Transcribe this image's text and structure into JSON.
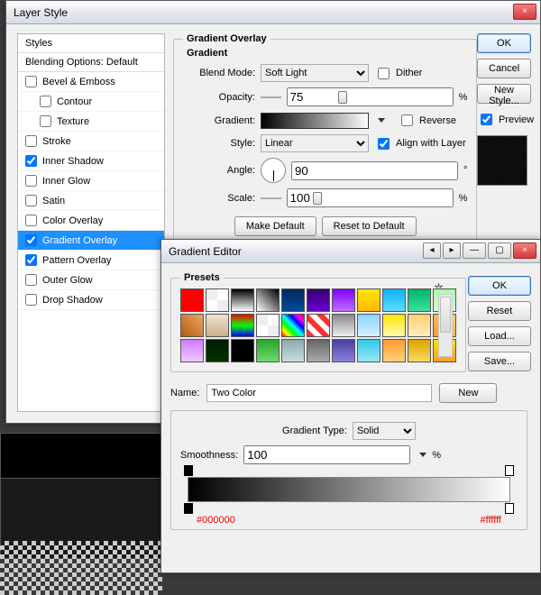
{
  "layer_style": {
    "title": "Layer Style",
    "list_header": "Styles",
    "blending_label": "Blending Options: Default",
    "effects": [
      {
        "label": "Bevel & Emboss",
        "checked": false,
        "selected": false,
        "indent": 0
      },
      {
        "label": "Contour",
        "checked": false,
        "selected": false,
        "indent": 1
      },
      {
        "label": "Texture",
        "checked": false,
        "selected": false,
        "indent": 1
      },
      {
        "label": "Stroke",
        "checked": false,
        "selected": false,
        "indent": 0
      },
      {
        "label": "Inner Shadow",
        "checked": true,
        "selected": false,
        "indent": 0
      },
      {
        "label": "Inner Glow",
        "checked": false,
        "selected": false,
        "indent": 0
      },
      {
        "label": "Satin",
        "checked": false,
        "selected": false,
        "indent": 0
      },
      {
        "label": "Color Overlay",
        "checked": false,
        "selected": false,
        "indent": 0
      },
      {
        "label": "Gradient Overlay",
        "checked": true,
        "selected": true,
        "indent": 0
      },
      {
        "label": "Pattern Overlay",
        "checked": true,
        "selected": false,
        "indent": 0
      },
      {
        "label": "Outer Glow",
        "checked": false,
        "selected": false,
        "indent": 0
      },
      {
        "label": "Drop Shadow",
        "checked": false,
        "selected": false,
        "indent": 0
      }
    ],
    "panel_title": "Gradient Overlay",
    "subgroup": "Gradient",
    "labels": {
      "blend_mode": "Blend Mode:",
      "opacity": "Opacity:",
      "gradient": "Gradient:",
      "style": "Style:",
      "angle": "Angle:",
      "scale": "Scale:",
      "dither": "Dither",
      "reverse": "Reverse",
      "align": "Align with Layer",
      "percent": "%",
      "degree": "°"
    },
    "values": {
      "blend_mode": "Soft Light",
      "opacity": "75",
      "style": "Linear",
      "angle": "90",
      "scale": "100",
      "dither": false,
      "reverse": false,
      "align": true
    },
    "buttons": {
      "make_default": "Make Default",
      "reset_default": "Reset to Default",
      "ok": "OK",
      "cancel": "Cancel",
      "new_style": "New Style...",
      "preview": "Preview"
    },
    "preview_checked": true
  },
  "gradient_editor": {
    "title": "Gradient Editor",
    "presets_label": "Presets",
    "name_label": "Name:",
    "name_value": "Two Color",
    "type_label": "Gradient Type:",
    "type_value": "Solid",
    "smooth_label": "Smoothness:",
    "smooth_value": "100",
    "percent": "%",
    "buttons": {
      "ok": "OK",
      "reset": "Reset",
      "load": "Load...",
      "save": "Save...",
      "new": "New"
    },
    "stops": {
      "left_color": "#000000",
      "right_color": "#ffffff"
    },
    "swatches": [
      "linear-gradient(#ff0000,#ff0000)",
      "repeating-conic-gradient(#fff 0 25%,#eee 0 50%)",
      "linear-gradient(#000,#fff)",
      "linear-gradient(45deg,#fff,#000)",
      "linear-gradient(#002a5c,#004a9c)",
      "linear-gradient(#34006b,#6a00d4)",
      "linear-gradient(#8000ff,#c070ff)",
      "linear-gradient(#ffe600,#ffb800)",
      "linear-gradient(#0eb3ff,#5edcff)",
      "linear-gradient(#00b36b,#3de29a)",
      "linear-gradient(#a5ffa5,#d9ffd9)",
      "linear-gradient(45deg,#b55a12,#e8a864)",
      "linear-gradient(#f0e3cf,#cbb089)",
      "linear-gradient(#ff0000,#00ff00,#0000ff)",
      "repeating-conic-gradient(#fff 0 25%,#eee 0 50%)",
      "linear-gradient(45deg,#ff0000,#ffff00,#00ff00,#00ffff,#0000ff,#ff00ff,#ff0000)",
      "repeating-linear-gradient(45deg,#ff3030 0 6px,#fff 6px 12px)",
      "linear-gradient(#888,#eee)",
      "linear-gradient(#8ad4ff,#d8f1ff)",
      "linear-gradient(#ffe600,#fff8b0)",
      "linear-gradient(#ffd070,#ffeec0)",
      "linear-gradient(45deg,#ff9a2e,#ffd27a)",
      "linear-gradient(#d07aff,#f0c8ff)",
      "linear-gradient(#001a00,#003300)",
      "linear-gradient(#000,#000)",
      "linear-gradient(#2aa52a,#6fd86f)",
      "linear-gradient(#8aa,#cdd)",
      "linear-gradient(#666,#aaa)",
      "linear-gradient(#4b3fa0,#8a7fe0)",
      "linear-gradient(#30c9e8,#9ae8f5)",
      "linear-gradient(#ff9a2e,#ffd27a)",
      "linear-gradient(#d9a400,#ffd95e)",
      "linear-gradient(#ffe600,#ff9a2e)"
    ]
  }
}
